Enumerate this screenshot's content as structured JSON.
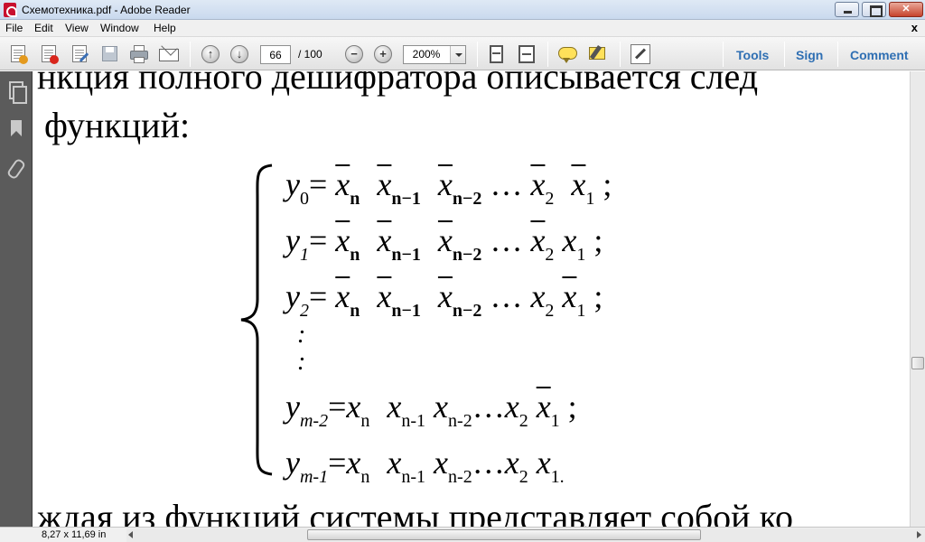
{
  "window": {
    "title": "Схемотехника.pdf - Adobe Reader",
    "close_glyph": "✕"
  },
  "menu": {
    "items": [
      "File",
      "Edit",
      "View",
      "Window",
      "Help"
    ],
    "doc_close": "x"
  },
  "toolbar": {
    "page_current": "66",
    "page_total": "/ 100",
    "zoom": "200%",
    "zoom_out_symbol": "−",
    "zoom_in_symbol": "+",
    "prev_symbol": "↑",
    "next_symbol": "↓",
    "links": [
      "Tools",
      "Sign",
      "Comment"
    ],
    "icons": [
      "create-pdf-icon",
      "convert-icon",
      "edit-icon",
      "save-icon",
      "print-icon",
      "email-icon",
      "prev-page-icon",
      "next-page-icon",
      "zoom-out-icon",
      "zoom-in-icon",
      "fit-page-icon",
      "fit-width-icon",
      "sticky-note-icon",
      "highlight-icon",
      "read-mode-icon"
    ]
  },
  "nav_pane": {
    "icons": [
      "pages-icon",
      "bookmarks-icon",
      "attachments-icon"
    ]
  },
  "document": {
    "line_top": "нкция полного дешифратора описывается след",
    "line_top2": "функций:",
    "line_bottom": "ждая из функций системы представляет собой ко",
    "equations": {
      "y0_left": "y",
      "y0_sub": "0",
      "y1_sub": "1",
      "y2_sub": "2",
      "ym2_sub": "m-2",
      "ym1_sub": "m-1",
      "eq": "=",
      "x": "x",
      "n": "n",
      "n1": "n−1",
      "n2": "n−2",
      "n1_plain": "n-1",
      "n2_plain": "n-2",
      "s2": "2",
      "s1": "1",
      "dots": "…",
      "dots3": "…",
      "semi": ";",
      "end": ".",
      "vdots": ":"
    }
  },
  "status": {
    "page_size": "8,27 x 11,69 in"
  }
}
